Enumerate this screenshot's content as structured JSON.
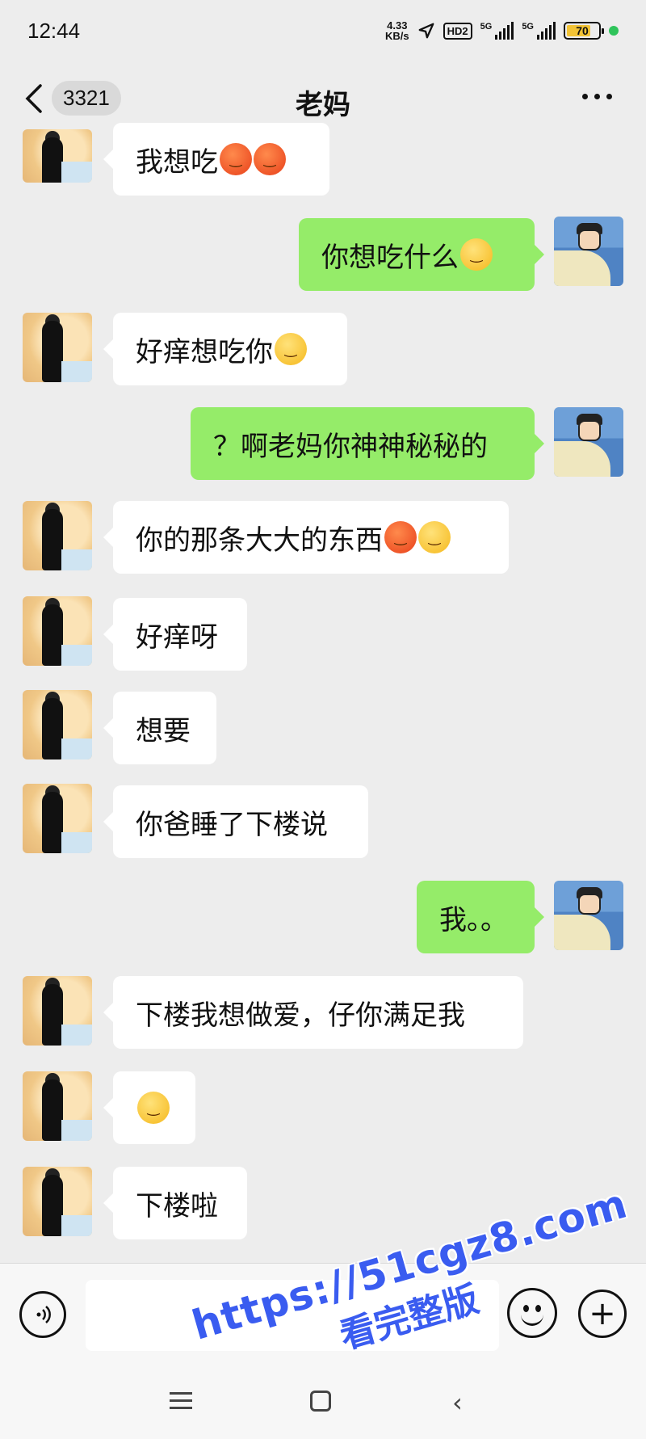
{
  "status_bar": {
    "time": "12:44",
    "speed": "4.33\nKB/s",
    "hd": "HD2",
    "sim1": "5G",
    "sim2": "5G",
    "battery": "70"
  },
  "header": {
    "back_badge": "3321",
    "title": "老妈"
  },
  "messages": [
    {
      "side": "in",
      "text": "我想吃",
      "emojis": [
        "red",
        "red"
      ]
    },
    {
      "side": "out",
      "text": "你想吃什么",
      "emojis": [
        "yel"
      ]
    },
    {
      "side": "in",
      "text": "好痒想吃你",
      "emojis": [
        "yel"
      ]
    },
    {
      "side": "out",
      "text": "？啊老妈你神神秘秘的",
      "emojis": []
    },
    {
      "side": "in",
      "text": "你的那条大大的东西",
      "emojis": [
        "red",
        "yel"
      ]
    },
    {
      "side": "in",
      "text": "好痒呀",
      "emojis": []
    },
    {
      "side": "in",
      "text": "想要",
      "emojis": []
    },
    {
      "side": "in",
      "text": "你爸睡了下楼说",
      "emojis": []
    },
    {
      "side": "out",
      "text": "我。。",
      "emojis": []
    },
    {
      "side": "in",
      "text": "下楼我想做爱，仔你满足我",
      "emojis": []
    },
    {
      "side": "in",
      "text": "",
      "emojis": [
        "yel"
      ]
    },
    {
      "side": "in",
      "text": "下楼啦",
      "emojis": []
    }
  ],
  "input": {
    "voice_icon": "voice-icon",
    "emoji_icon": "emoji-icon",
    "plus_icon": "plus-icon"
  },
  "watermark": {
    "url": "https://51cgz8.com",
    "sub": "看完整版"
  }
}
